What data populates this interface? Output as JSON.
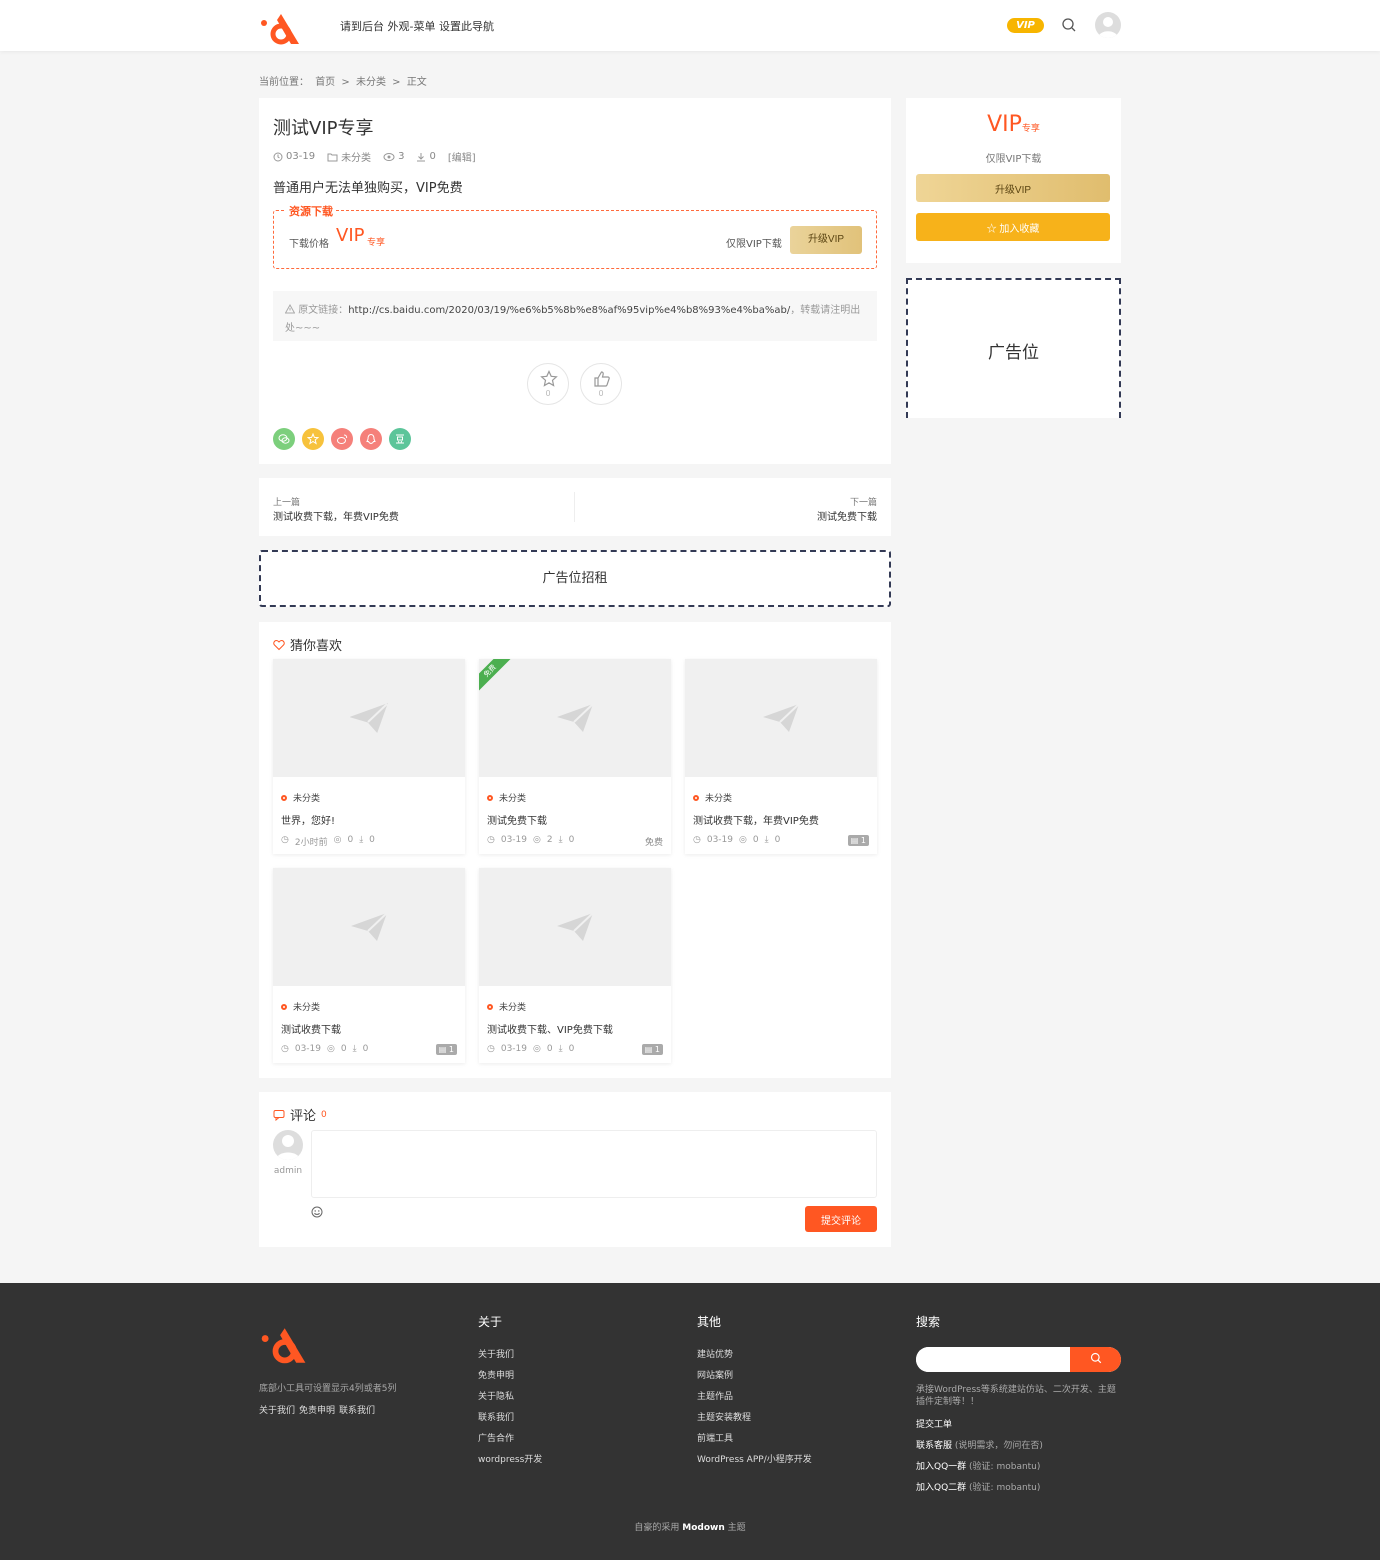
{
  "header": {
    "nav_hint": "请到后台 外观-菜单 设置此导航",
    "vip_badge": "VIP"
  },
  "breadcrumb": {
    "prefix": "当前位置：",
    "home": "首页",
    "category": "未分类",
    "current": "正文",
    "separator": ">"
  },
  "post": {
    "title": "测试VIP专享",
    "date": "03-19",
    "category": "未分类",
    "views": "3",
    "downloads": "0",
    "edit": "[编辑]",
    "description": "普通用户无法单独购买，VIP免费",
    "download": {
      "legend": "资源下载",
      "price_label": "下载价格",
      "vip": "VIP",
      "vip_sub": "专享",
      "only_vip": "仅限VIP下载",
      "upgrade": "升级VIP"
    },
    "source": {
      "label": "原文链接：",
      "url": "http://cs.baidu.com/2020/03/19/%e6%b5%8b%e8%af%95vip%e4%b8%93%e4%ba%ab/",
      "note": "，转载请注明出处~~~"
    },
    "favorite_count": "0",
    "like_count": "0",
    "share_colors": [
      "#7ccf7c",
      "#f7c23c",
      "#f5807a",
      "#f5807a",
      "#5cc59a"
    ]
  },
  "post_nav": {
    "prev_label": "上一篇",
    "prev_title": "测试收费下载，年费VIP免费",
    "next_label": "下一篇",
    "next_title": "测试免费下载"
  },
  "ad_banner": "广告位招租",
  "related": {
    "title": "猜你喜欢",
    "items": [
      {
        "category": "未分类",
        "title": "世界，您好!",
        "date": "2小时前",
        "views": "0",
        "downloads": "0",
        "badge": "",
        "count": ""
      },
      {
        "category": "未分类",
        "title": "测试免费下载",
        "date": "03-19",
        "views": "2",
        "downloads": "0",
        "badge": "免费",
        "count": "",
        "ribbon": "免费"
      },
      {
        "category": "未分类",
        "title": "测试收费下载，年费VIP免费",
        "date": "03-19",
        "views": "0",
        "downloads": "0",
        "badge": "",
        "count": "1"
      },
      {
        "category": "未分类",
        "title": "测试收费下载",
        "date": "03-19",
        "views": "0",
        "downloads": "0",
        "badge": "",
        "count": "1"
      },
      {
        "category": "未分类",
        "title": "测试收费下载、VIP免费下载",
        "date": "03-19",
        "views": "0",
        "downloads": "0",
        "badge": "",
        "count": "1"
      }
    ]
  },
  "comments": {
    "title": "评论",
    "count": "0",
    "user": "admin",
    "submit": "提交评论"
  },
  "sidebar": {
    "vip": "VIP",
    "vip_sub": "专享",
    "only_vip": "仅限VIP下载",
    "upgrade": "升级VIP",
    "favorite": "加入收藏",
    "ad": "广告位"
  },
  "footer": {
    "desc": "底部小工具可设置显示4列或者5列",
    "small_links": [
      "关于我们",
      "免责申明",
      "联系我们"
    ],
    "about": {
      "title": "关于",
      "links": [
        "关于我们",
        "免责申明",
        "关于隐私",
        "联系我们",
        "广告合作",
        "wordpress开发"
      ]
    },
    "other": {
      "title": "其他",
      "links": [
        "建站优势",
        "网站案例",
        "主题作品",
        "主题安装教程",
        "前端工具",
        "WordPress APP/小程序开发"
      ]
    },
    "search": {
      "title": "搜索",
      "note": "承接WordPress等系统建站仿站、二次开发、主题插件定制等！！",
      "ticket": "提交工单",
      "service": "联系客服",
      "service_note": "(说明需求，勿问在否)",
      "qq1": "加入QQ一群",
      "qq1_note": "(验证: mobantu)",
      "qq2": "加入QQ二群",
      "qq2_note": "(验证: mobantu)"
    },
    "copyright_prefix": "自豪的采用",
    "copyright_theme": "Modown",
    "copyright_suffix": "主题"
  }
}
